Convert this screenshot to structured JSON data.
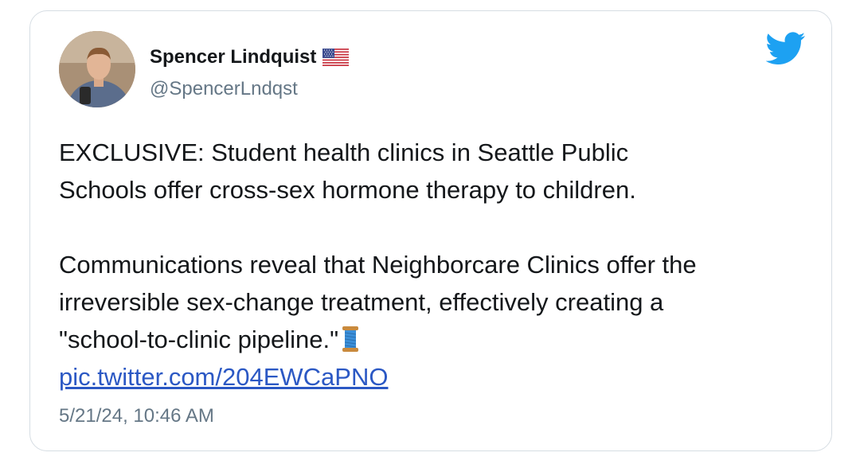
{
  "tweet": {
    "author_name": "Spencer Lindquist",
    "author_flag": "us-flag-emoji",
    "handle": "@SpencerLndqst",
    "brand_icon": "twitter-bird-icon",
    "brand_color": "#1da1f2",
    "text_paragraph_1": [
      "EXCLUSIVE: Student health clinics in Seattle Public",
      "Schools offer cross-sex hormone therapy to children."
    ],
    "text_paragraph_2": [
      "Communications reveal that Neighborcare Clinics offer the",
      "irreversible sex-change treatment, effectively creating a",
      "\"school-to-clinic pipeline.\""
    ],
    "trailing_emoji": "spool-of-thread-emoji",
    "link_text": "pic.twitter.com/204EWCaPNO",
    "link_color": "#2b58c4",
    "timestamp": "5/21/24, 10:46 AM"
  }
}
